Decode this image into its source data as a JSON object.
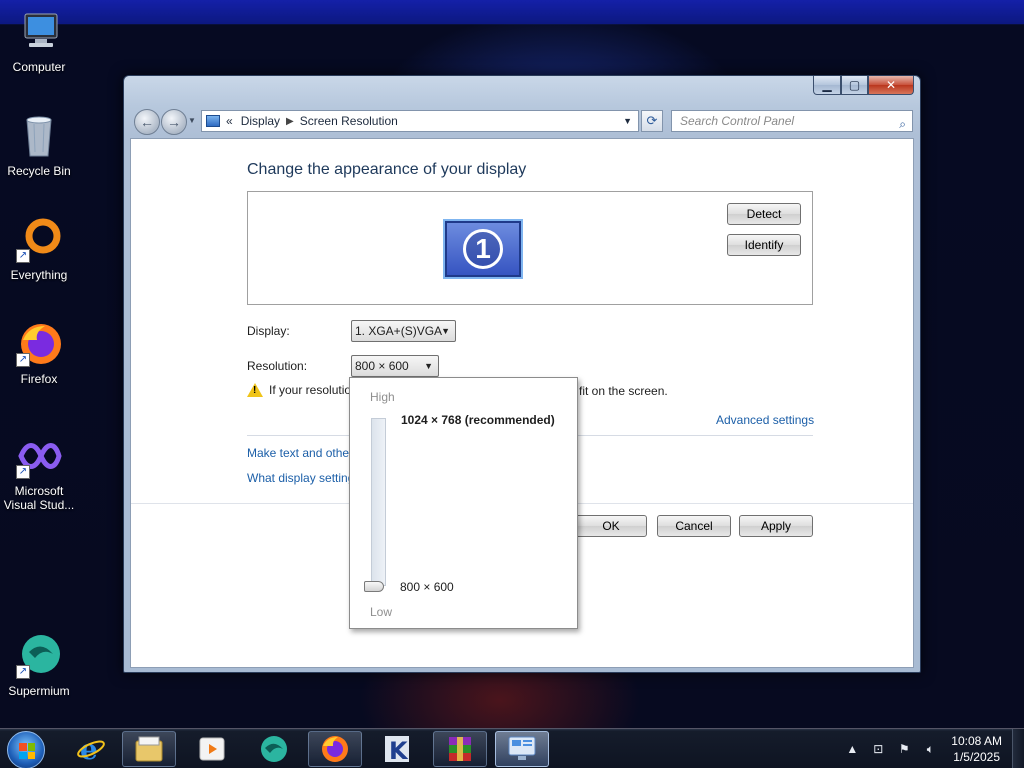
{
  "desktop": {
    "icons": [
      {
        "label": "Computer",
        "icon": "computer-icon"
      },
      {
        "label": "Recycle Bin",
        "icon": "recycle-bin-icon"
      },
      {
        "label": "Everything",
        "icon": "everything-icon"
      },
      {
        "label": "Firefox",
        "icon": "firefox-icon"
      },
      {
        "label": "Microsoft Visual Stud...",
        "icon": "visual-studio-icon"
      },
      {
        "label": "Supermium",
        "icon": "supermium-icon"
      }
    ]
  },
  "window": {
    "address": {
      "chevrons": "«",
      "crumb1": "Display",
      "crumb2": "Screen Resolution"
    },
    "search": {
      "placeholder": "Search Control Panel"
    },
    "title": "Change the appearance of your display",
    "monitor_number": "1",
    "buttons": {
      "detect": "Detect",
      "identify": "Identify",
      "ok": "OK",
      "cancel": "Cancel",
      "apply": "Apply"
    },
    "display_label": "Display:",
    "display_value": "1. XGA+(S)VGA",
    "resolution_label": "Resolution:",
    "resolution_value": "800 × 600",
    "warning_visible": "If your resolutio",
    "warning_tail": "fit on the screen.",
    "advanced_settings": "Advanced settings",
    "link_text_size": "Make text and other",
    "link_display_settings": "What display setting"
  },
  "resolution_dropdown": {
    "high_label": "High",
    "low_label": "Low",
    "recommended": "1024 × 768 (recommended)",
    "current": "800 × 600",
    "slider_level": 0.0
  },
  "taskbar": {
    "pinned": [
      "internet-explorer-icon",
      "file-explorer-icon",
      "media-player-icon",
      "supermium-icon",
      "firefox-icon",
      "k-app-icon",
      "winrar-icon",
      "control-panel-icon"
    ],
    "active": "control-panel-icon",
    "clock_time": "10:08 AM",
    "clock_date": "1/5/2025"
  }
}
